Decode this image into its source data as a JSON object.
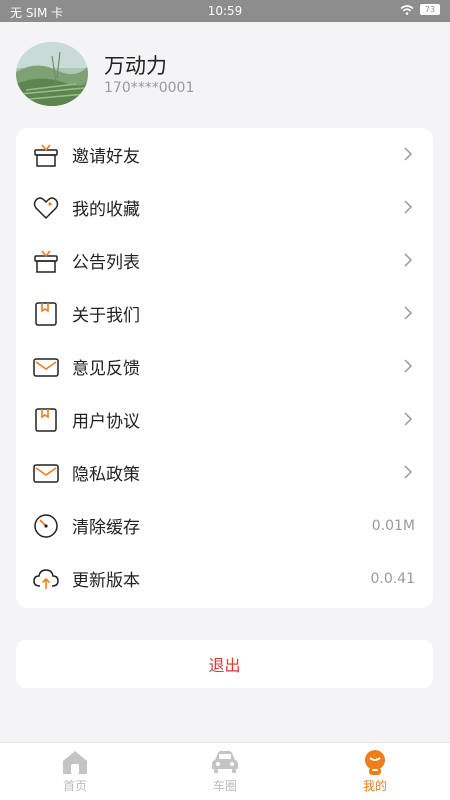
{
  "status_bar": {
    "carrier": "无 SIM 卡",
    "time": "10:59",
    "battery": "73"
  },
  "profile": {
    "name": "万动力",
    "phone": "170****0001"
  },
  "menu": {
    "items": [
      {
        "label": "邀请好友",
        "icon": "gift-icon"
      },
      {
        "label": "我的收藏",
        "icon": "heart-icon"
      },
      {
        "label": "公告列表",
        "icon": "gift-icon"
      },
      {
        "label": "关于我们",
        "icon": "bookmark-icon"
      },
      {
        "label": "意见反馈",
        "icon": "mail-icon"
      },
      {
        "label": "用户协议",
        "icon": "bookmark-icon"
      },
      {
        "label": "隐私政策",
        "icon": "mail-icon"
      },
      {
        "label": "清除缓存",
        "icon": "gauge-icon",
        "value": "0.01M"
      },
      {
        "label": "更新版本",
        "icon": "cloud-upload-icon",
        "value": "0.0.41"
      }
    ]
  },
  "logout_label": "退出",
  "tabbar": {
    "tabs": [
      {
        "label": "首页",
        "icon": "home-icon"
      },
      {
        "label": "车圈",
        "icon": "car-icon"
      },
      {
        "label": "我的",
        "icon": "profile-icon"
      }
    ],
    "active": "我的"
  },
  "colors": {
    "accent": "#f07d1c",
    "logout": "#e2352c",
    "inactive_tab": "#bbbbbb"
  }
}
